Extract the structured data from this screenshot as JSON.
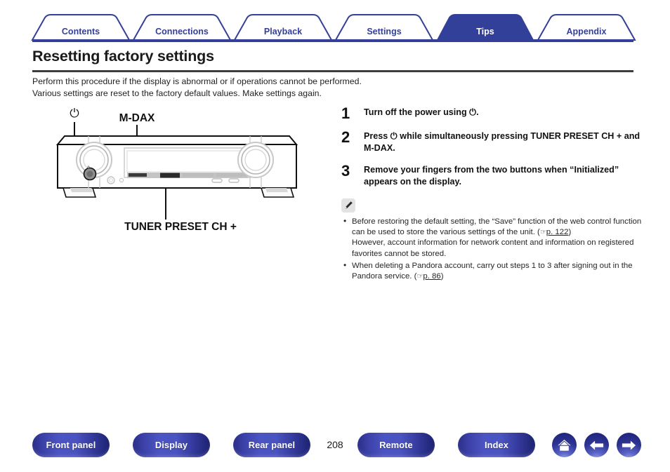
{
  "tabs": [
    {
      "label": "Contents",
      "active": false
    },
    {
      "label": "Connections",
      "active": false
    },
    {
      "label": "Playback",
      "active": false
    },
    {
      "label": "Settings",
      "active": false
    },
    {
      "label": "Tips",
      "active": true
    },
    {
      "label": "Appendix",
      "active": false
    }
  ],
  "colors": {
    "brand_blue": "#343f99",
    "active_tab": "#33409a",
    "rule": "#3d3d3d",
    "note_icon_bg": "#e3e3e3"
  },
  "page_title": "Resetting factory settings",
  "intro": {
    "line1": "Perform this procedure if the display is abnormal or if operations cannot be performed.",
    "line2": "Various settings are reset to the factory default values. Make settings again."
  },
  "figure": {
    "power_glyph": "⏻",
    "label_mdax": "M-DAX",
    "label_tuner": "TUNER PRESET CH +"
  },
  "steps": [
    {
      "number": "1",
      "text": "Turn off the power using ⏻."
    },
    {
      "number": "2",
      "text": "Press ⏻ while simultaneously pressing TUNER PRESET CH + and M-DAX."
    },
    {
      "number": "3",
      "text": "Remove your fingers from the two buttons when “Initialized” appears on the display."
    }
  ],
  "note": {
    "icon": "pencil-icon",
    "items": [
      {
        "text_before": "Before restoring the default setting, the “Save” function of the web control function can be used to store the various settings of the unit.  (",
        "hand": "☞",
        "link": "p. 122",
        "text_after": ")",
        "text_tail": "However, account information for network content and information on registered favorites cannot be stored."
      },
      {
        "text_before": "When deleting a Pandora account, carry out steps 1 to 3 after signing out in the Pandora service.  (",
        "hand": "☞",
        "link": "p. 86",
        "text_after": ")",
        "text_tail": ""
      }
    ]
  },
  "footer": {
    "buttons": [
      {
        "label": "Front panel"
      },
      {
        "label": "Display"
      },
      {
        "label": "Rear panel"
      },
      {
        "label": "Remote"
      },
      {
        "label": "Index"
      }
    ],
    "page_number": "208",
    "icons": [
      {
        "name": "home-icon"
      },
      {
        "name": "arrow-left-icon"
      },
      {
        "name": "arrow-right-icon"
      }
    ]
  }
}
